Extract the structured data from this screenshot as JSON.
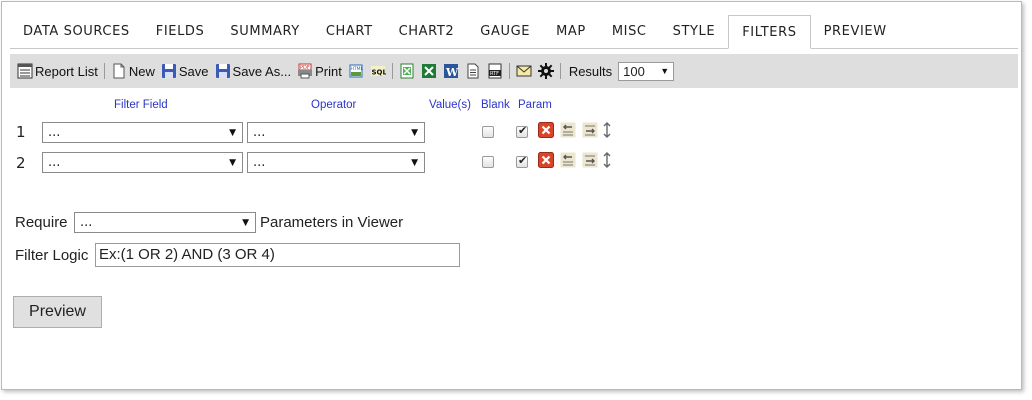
{
  "tabs": [
    "DATA SOURCES",
    "FIELDS",
    "SUMMARY",
    "CHART",
    "CHART2",
    "GAUGE",
    "MAP",
    "MISC",
    "STYLE",
    "FILTERS",
    "PREVIEW"
  ],
  "active_tab": "FILTERS",
  "toolbar": {
    "report_list": "Report List",
    "new": "New",
    "save": "Save",
    "save_as": "Save As...",
    "print": "Print",
    "results_label": "Results",
    "results_value": "100"
  },
  "columns": {
    "filter_field": "Filter Field",
    "operator": "Operator",
    "values": "Value(s)",
    "blank": "Blank",
    "param": "Param"
  },
  "filters": [
    {
      "num": "1",
      "field": "...",
      "operator": "...",
      "blank": false,
      "param": true
    },
    {
      "num": "2",
      "field": "...",
      "operator": "...",
      "blank": false,
      "param": true
    }
  ],
  "require": {
    "label": "Require",
    "value": "...",
    "suffix": "Parameters in Viewer"
  },
  "filter_logic": {
    "label": "Filter Logic",
    "value": "Ex:(1 OR 2) AND (3 OR 4)"
  },
  "preview_button": "Preview"
}
